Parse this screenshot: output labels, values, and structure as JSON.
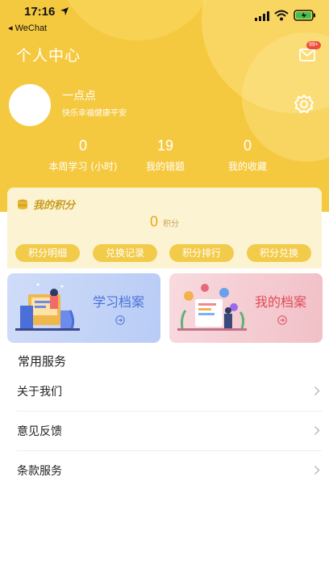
{
  "status_bar": {
    "time": "17:16",
    "back_app": "◂ WeChat"
  },
  "header": {
    "title": "个人中心",
    "mail_badge": "99+"
  },
  "user": {
    "name": "一点点",
    "motto": "快乐幸福健康平安"
  },
  "stats": [
    {
      "value": "0",
      "label": "本周学习 (小时)"
    },
    {
      "value": "19",
      "label": "我的错题"
    },
    {
      "value": "0",
      "label": "我的收藏"
    }
  ],
  "points": {
    "title": "我的积分",
    "value": "0",
    "unit": "积分",
    "buttons": [
      "积分明细",
      "兑换记录",
      "积分排行",
      "积分兑换"
    ]
  },
  "archives": [
    {
      "title": "学习档案"
    },
    {
      "title": "我的档案"
    }
  ],
  "services": {
    "title": "常用服务",
    "items": [
      "关于我们",
      "意见反馈",
      "条款服务"
    ]
  },
  "colors": {
    "brand_yellow": "#f5c93f",
    "study_blue": "#4a72d8",
    "mine_red": "#e04b57"
  },
  "icons": [
    "location-arrow-icon",
    "signal-icon",
    "wifi-icon",
    "battery-icon",
    "mail-icon",
    "gear-icon",
    "coin-stack-icon",
    "arrow-circle-icon",
    "chevron-right-icon"
  ]
}
